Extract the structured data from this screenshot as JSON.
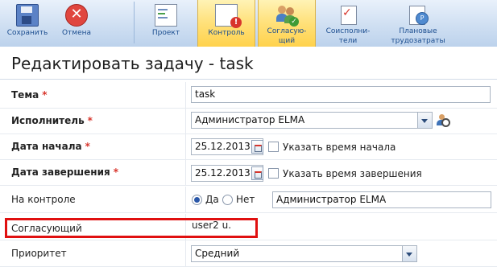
{
  "toolbar": {
    "buttons": [
      {
        "key": "save",
        "label": "Сохранить",
        "icon": "save-icon"
      },
      {
        "key": "cancel",
        "label": "Отмена",
        "icon": "cancel-icon"
      },
      {
        "key": "project",
        "label": "Проект",
        "icon": "project-icon"
      },
      {
        "key": "control",
        "label": "Контроль",
        "icon": "control-icon",
        "active": true
      },
      {
        "key": "approver",
        "label": "Согласую-\nщий",
        "icon": "approver-icon",
        "active": true
      },
      {
        "key": "coexec",
        "label": "Соисполни-\nтели",
        "icon": "coexecutors-icon"
      },
      {
        "key": "plan",
        "label": "Плановые\nтрудозатраты",
        "icon": "planned-effort-icon"
      }
    ],
    "cancel_glyph": "✕",
    "control_badge": "!",
    "approver_check": "✓",
    "coexec_check": "✓",
    "plan_glyph": "P"
  },
  "page": {
    "title": "Редактировать задачу - task"
  },
  "form": {
    "topic": {
      "label": "Тема",
      "required": "*",
      "value": "task"
    },
    "executor": {
      "label": "Исполнитель",
      "required": "*",
      "value": "Администратор ELMA"
    },
    "start_date": {
      "label": "Дата начала",
      "required": "*",
      "value": "25.12.2013",
      "checkbox_label": "Указать время начала"
    },
    "end_date": {
      "label": "Дата завершения",
      "required": "*",
      "value": "25.12.2013",
      "checkbox_label": "Указать время завершения"
    },
    "on_control": {
      "label": "На контроле",
      "yes": "Да",
      "no": "Нет",
      "selected": "Да",
      "controller": "Администратор ELMA"
    },
    "approver": {
      "label": "Согласующий",
      "value": "user2 u."
    },
    "priority": {
      "label": "Приоритет",
      "value": "Средний"
    }
  },
  "colors": {
    "accent": "#e01010",
    "toolbar_active": "#ffd24c",
    "required": "#d8352c"
  }
}
